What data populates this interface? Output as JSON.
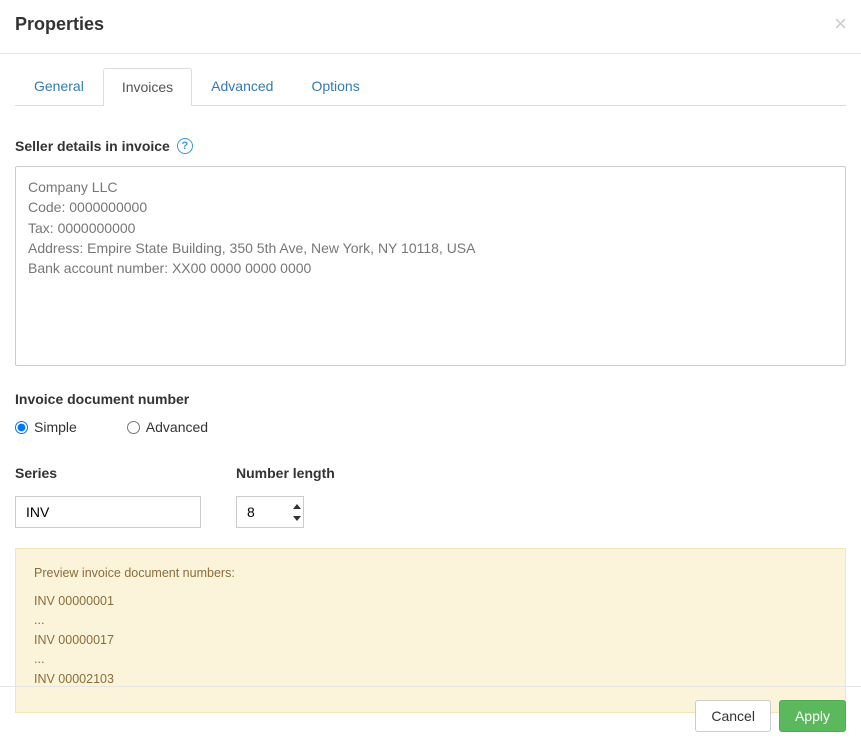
{
  "header": {
    "title": "Properties"
  },
  "tabs": {
    "general": "General",
    "invoices": "Invoices",
    "advanced": "Advanced",
    "options": "Options"
  },
  "seller": {
    "label": "Seller details in invoice",
    "value": "Company LLC\nCode: 0000000000\nTax: 0000000000\nAddress: Empire State Building, 350 5th Ave, New York, NY 10118, USA\nBank account number: XX00 0000 0000 0000"
  },
  "docnum": {
    "label": "Invoice document number",
    "simple": "Simple",
    "advanced": "Advanced"
  },
  "series": {
    "label": "Series",
    "value": "INV"
  },
  "numlen": {
    "label": "Number length",
    "value": "8"
  },
  "preview": {
    "title": "Preview invoice document numbers",
    "line1": "INV 00000001",
    "sep1": "...",
    "line2": "INV 00000017",
    "sep2": "...",
    "line3": "INV 00002103"
  },
  "footer": {
    "cancel": "Cancel",
    "apply": "Apply"
  }
}
